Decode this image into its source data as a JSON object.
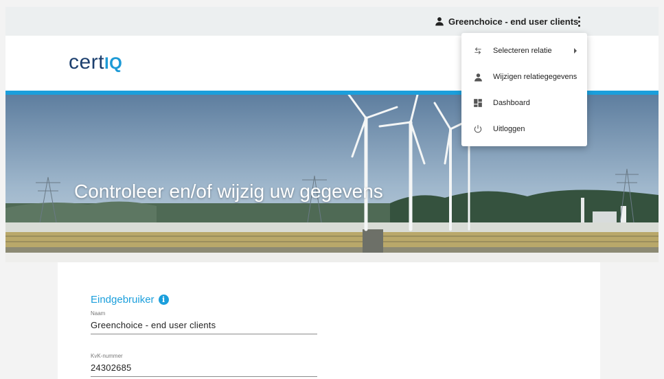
{
  "topbar": {
    "user_name": "Greenchoice - end user clients",
    "user_icon": "person-icon",
    "menu_icon": "more-vert-icon"
  },
  "logo": {
    "text_main": "cert",
    "text_accent": "IQ"
  },
  "hero": {
    "title": "Controleer en/of wijzig uw gegevens"
  },
  "section": {
    "title": "Eindgebruiker",
    "info_icon": "info-icon",
    "fields": [
      {
        "label": "Naam",
        "value": "Greenchoice - end user clients"
      },
      {
        "label": "KvK-nummer",
        "value": "24302685"
      }
    ]
  },
  "menu": {
    "items": [
      {
        "label": "Selecteren relatie",
        "icon": "swap-horiz-icon",
        "has_submenu": true
      },
      {
        "label": "Wijzigen relatiegegevens",
        "icon": "person-icon"
      },
      {
        "label": "Dashboard",
        "icon": "dashboard-icon"
      },
      {
        "label": "Uitloggen",
        "icon": "power-icon"
      }
    ]
  },
  "colors": {
    "accent": "#1b9fdc",
    "logo_dark": "#1c3f6e",
    "topbar": "#eceff0"
  }
}
